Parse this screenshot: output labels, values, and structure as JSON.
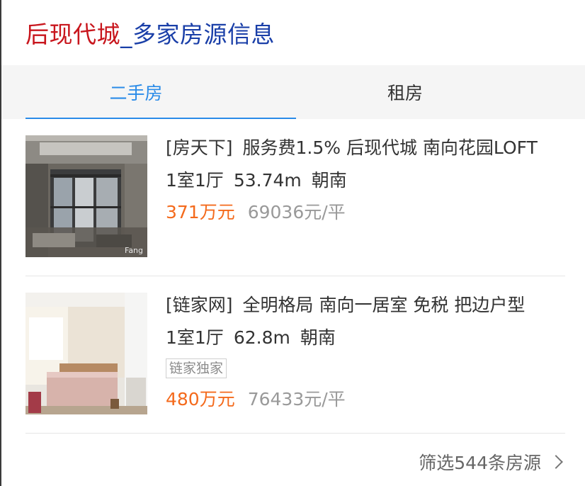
{
  "header": {
    "title_part1": "后现代城",
    "title_part2": "_多家房源信息"
  },
  "tabs": [
    {
      "label": "二手房",
      "active": true
    },
    {
      "label": "租房",
      "active": false
    }
  ],
  "listings": [
    {
      "source": "[房天下]",
      "title": "服务费1.5% 后现代城 南向花园LOFT",
      "layout": "1室1厅",
      "area": "53.74m",
      "orientation": "朝南",
      "tag": "",
      "price": "371万元",
      "unit_price": "69036元/平",
      "image_watermark": "Fang"
    },
    {
      "source": "[链家网]",
      "title": "全明格局 南向一居室 免税 把边户型",
      "layout": "1室1厅",
      "area": "62.8m",
      "orientation": "朝南",
      "tag": "链家独家",
      "price": "480万元",
      "unit_price": "76433元/平"
    }
  ],
  "footer": {
    "filter_text": "筛选544条房源"
  },
  "colors": {
    "title_red": "#c8161d",
    "title_blue": "#1a3fa8",
    "tab_active": "#2a8be8",
    "price": "#f46a1c"
  }
}
